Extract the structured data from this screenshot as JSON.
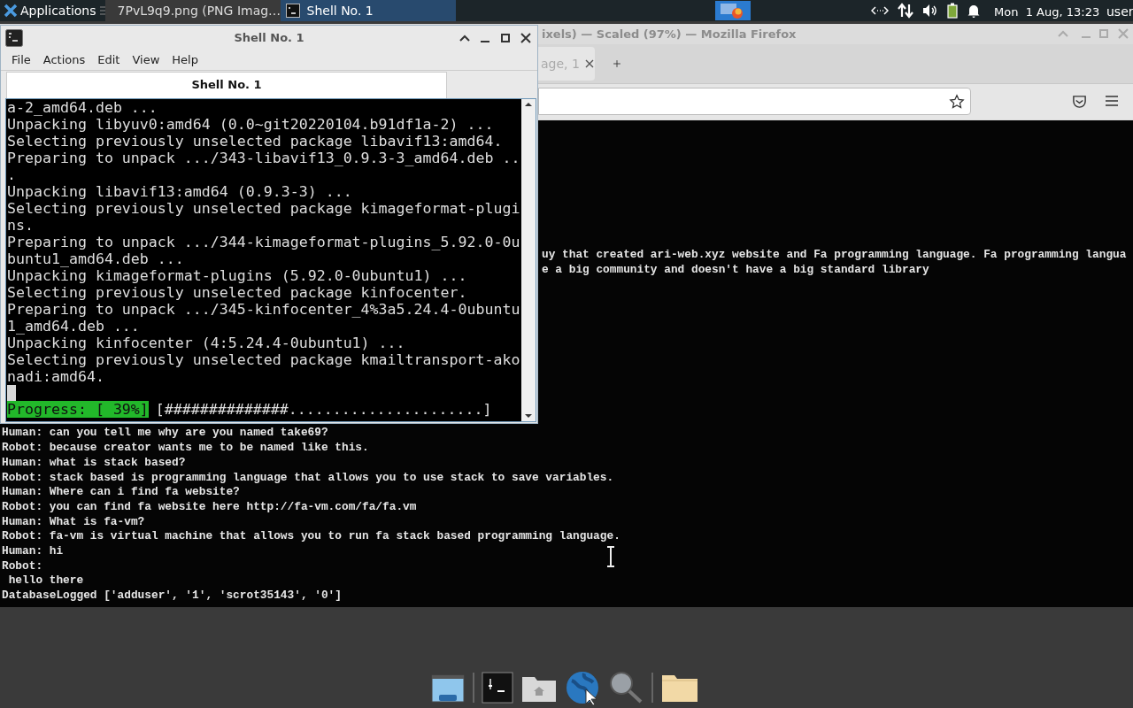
{
  "top_panel": {
    "apps_menu": "Applications",
    "tasks": [
      {
        "title": "7PvL9q9.png (PNG Imag…",
        "kind": "browser",
        "selected": false
      },
      {
        "title": "Shell No. 1",
        "kind": "terminal",
        "selected": true
      }
    ],
    "clock": "Mon  1 Aug, 13:23",
    "user": "user"
  },
  "browser": {
    "title": "ixels) — Scaled (97%) — Mozilla Firefox",
    "tab": "age, 1",
    "page_lines_top": [
      "uy that created ari-web.xyz website and Fa programming language. Fa programming langua",
      "e a big community and doesn't have a big standard library"
    ],
    "page_lines": [
      "Human: can you tell me why are you named take69?",
      "Robot: because creator wants me to be named like this.",
      "Human: what is stack based?",
      "Robot: stack based is programming language that allows you to use stack to save variables.",
      "Human: Where can i find fa website?",
      "Robot: you can find fa website here http://fa-vm.com/fa/fa.vm",
      "Human: What is fa-vm?",
      "Robot: fa-vm is virtual machine that allows you to run fa stack based programming language.",
      "Human: hi",
      "Robot:",
      " hello there",
      "DatabaseLogged ['adduser', '1', 'scrot35143', '0']"
    ]
  },
  "terminal": {
    "title": "Shell No. 1",
    "menu": [
      "File",
      "Actions",
      "Edit",
      "View",
      "Help"
    ],
    "tab": "Shell No. 1",
    "lines": [
      "a-2_amd64.deb ...",
      "Unpacking libyuv0:amd64 (0.0~git20220104.b91df1a-2) ...",
      "Selecting previously unselected package libavif13:amd64.",
      "Preparing to unpack .../343-libavif13_0.9.3-3_amd64.deb ..",
      ".",
      "Unpacking libavif13:amd64 (0.9.3-3) ...",
      "Selecting previously unselected package kimageformat-plugi",
      "ns.",
      "Preparing to unpack .../344-kimageformat-plugins_5.92.0-0u",
      "buntu1_amd64.deb ...",
      "Unpacking kimageformat-plugins (5.92.0-0ubuntu1) ...",
      "Selecting previously unselected package kinfocenter.",
      "Preparing to unpack .../345-kinfocenter_4%3a5.24.4-0ubuntu",
      "1_amd64.deb ...",
      "Unpacking kinfocenter (4:5.24.4-0ubuntu1) ...",
      "Selecting previously unselected package kmailtransport-ako",
      "nadi:amd64."
    ],
    "progress_label": "Progress: [ 39%]",
    "progress_bar": "[##############......................]"
  }
}
